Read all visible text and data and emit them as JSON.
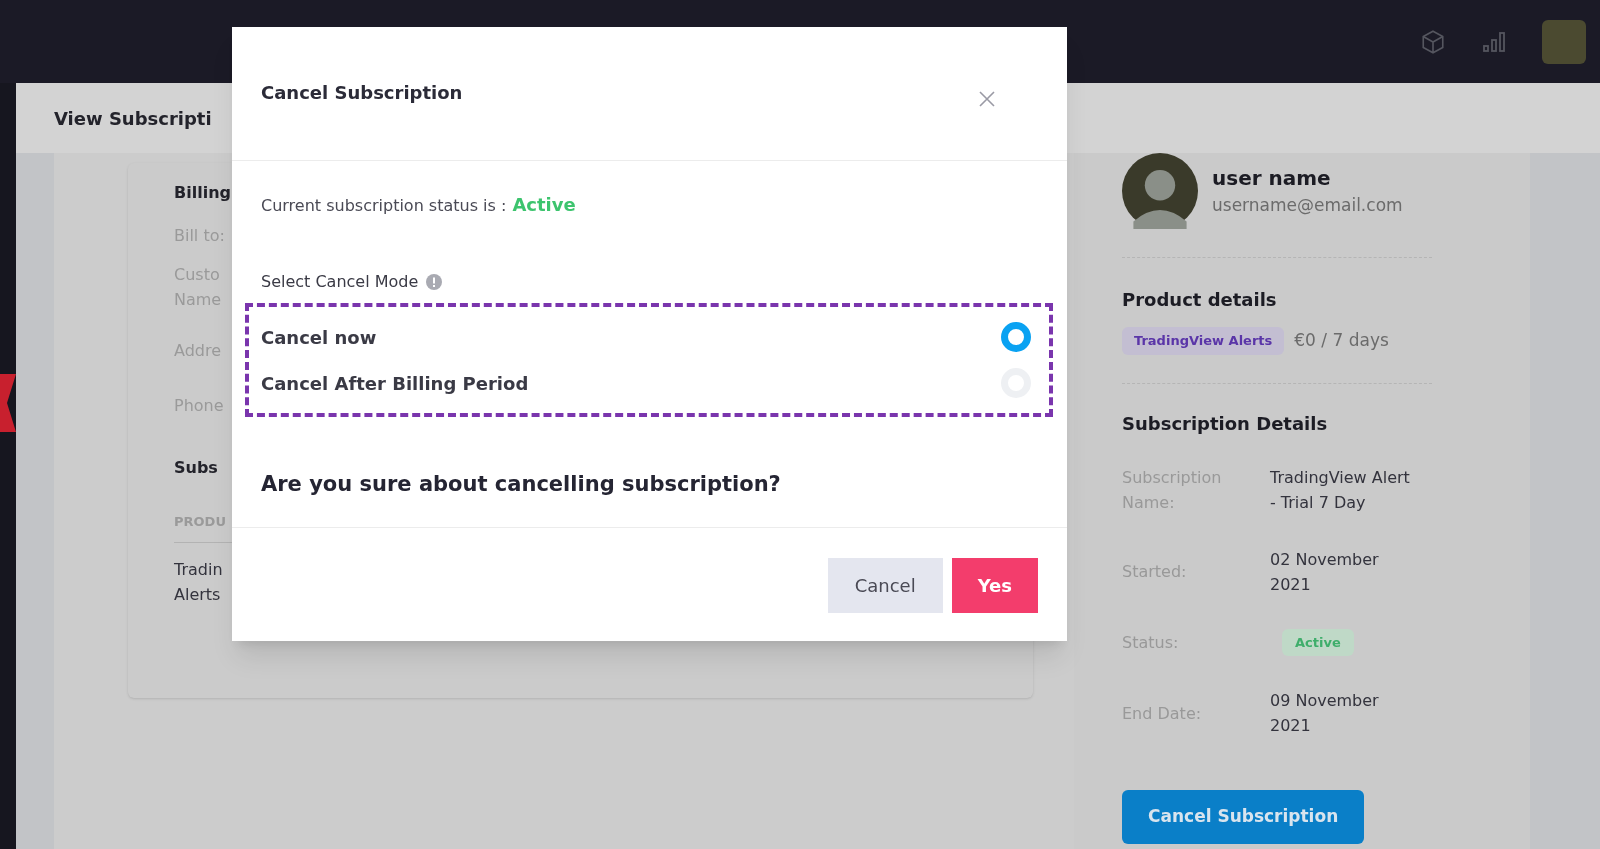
{
  "page": {
    "title": "View Subscripti"
  },
  "billing_card": {
    "heading": "Billing",
    "fields": [
      "Bill to:",
      "Custo",
      "Name",
      "Addre",
      "Phone"
    ],
    "section_heading": "Subs",
    "column": "PRODU",
    "cell_lines": [
      "Tradin",
      "Alerts"
    ]
  },
  "profile": {
    "name": "user name",
    "email": "username@email.com"
  },
  "product_details": {
    "heading": "Product details",
    "tag": "TradingView Alerts",
    "price": "€0 / 7 days"
  },
  "subscription_details": {
    "heading": "Subscription Details",
    "rows": [
      {
        "kind": "text",
        "label": "Subscription Name:",
        "value": "TradingView Alert - Trial 7 Day"
      },
      {
        "kind": "text",
        "label": "Started:",
        "value": "02 November 2021"
      },
      {
        "kind": "badge",
        "label": "Status:",
        "value": "Active"
      },
      {
        "kind": "text",
        "label": "End Date:",
        "value": "09 November 2021"
      }
    ]
  },
  "cancel_button": "Cancel Subscription",
  "modal": {
    "title": "Cancel Subscription",
    "status_prefix": "Current subscription status is :",
    "status_value": "Active",
    "mode_label": "Select Cancel Mode",
    "options": [
      {
        "label": "Cancel now",
        "selected": true
      },
      {
        "label": "Cancel After Billing Period",
        "selected": false
      }
    ],
    "question": "Are you sure about cancelling subscription?",
    "buttons": [
      {
        "label": "Cancel",
        "kind": "secondary"
      },
      {
        "label": "Yes",
        "kind": "primary"
      }
    ]
  }
}
